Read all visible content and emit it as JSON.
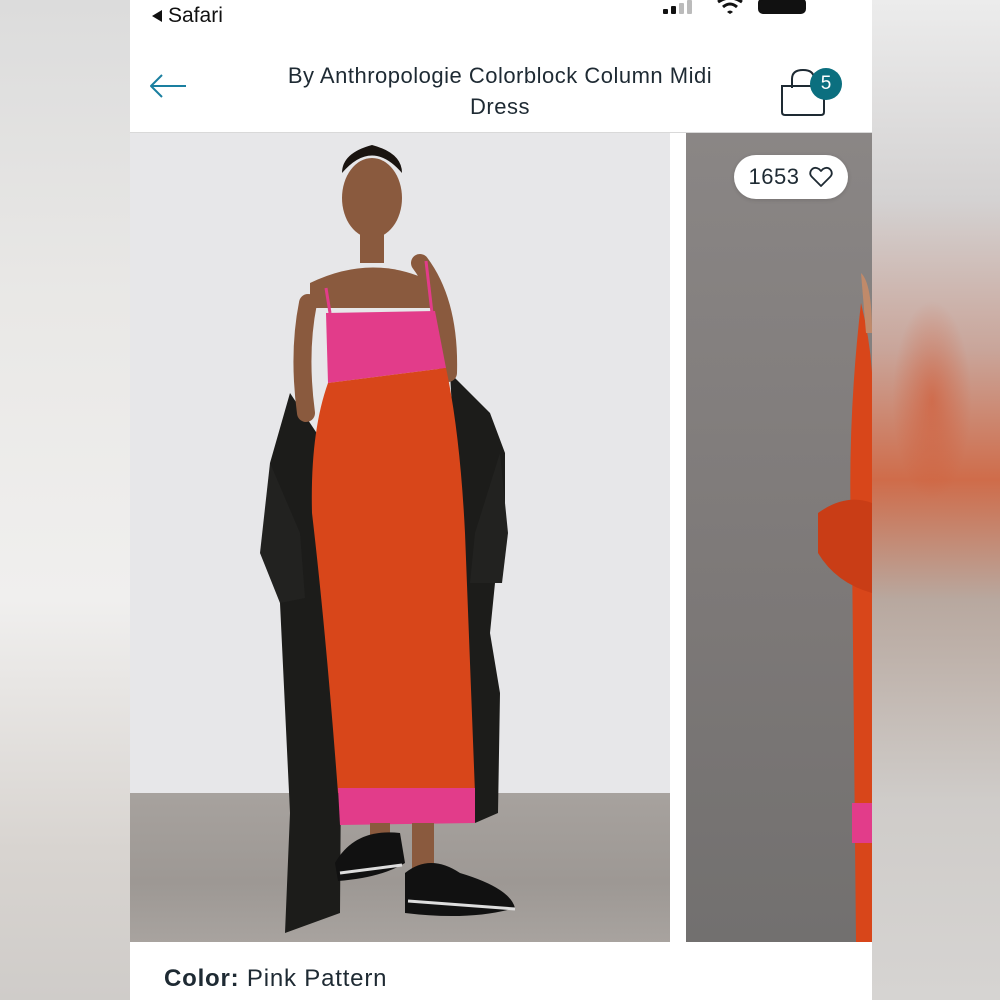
{
  "status_bar": {
    "back_app_label": "Safari"
  },
  "header": {
    "title": "By Anthropologie Colorblock Column Midi Dress",
    "bag_count": "5"
  },
  "gallery": {
    "likes": "1653"
  },
  "color_selector": {
    "label": "Color:",
    "value": "Pink Pattern"
  },
  "colors": {
    "accent": "#0b6f7f",
    "dress_orange": "#d8461a",
    "dress_pink": "#e23c8a",
    "coat": "#1c1c1a"
  },
  "icons": [
    "signal-icon",
    "wifi-icon",
    "battery-icon",
    "back-arrow-icon",
    "shopping-bag-icon",
    "heart-icon"
  ]
}
